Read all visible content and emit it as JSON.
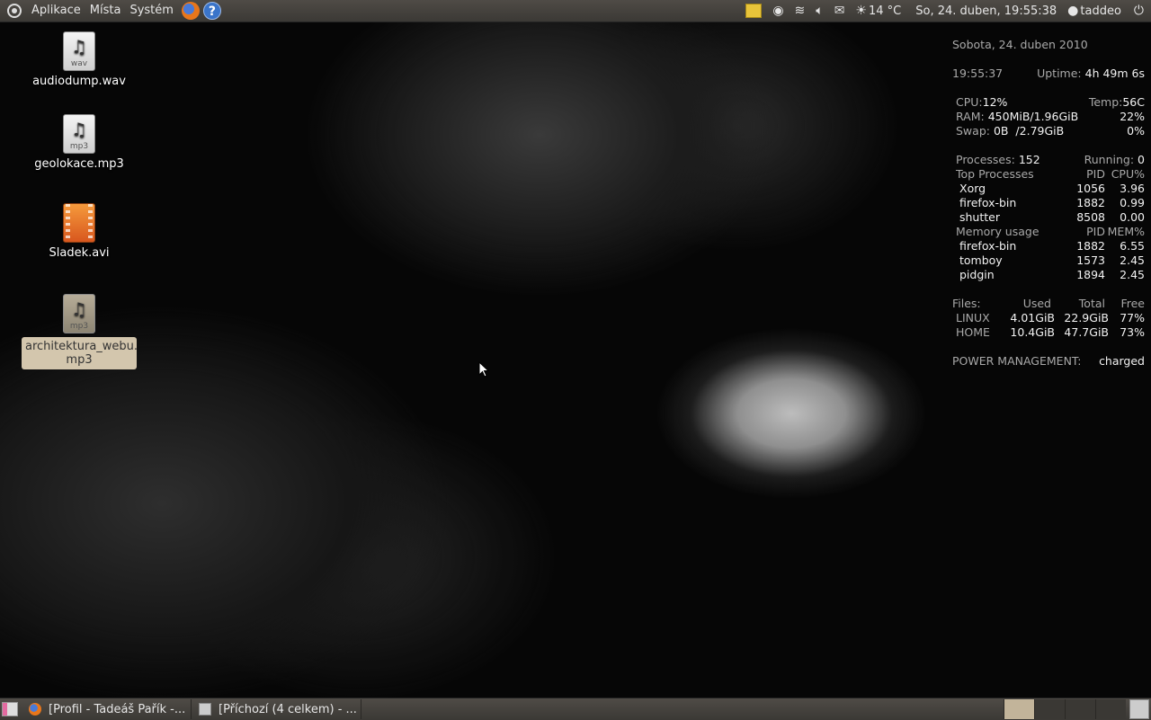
{
  "top_panel": {
    "menus": [
      "Aplikace",
      "Místa",
      "Systém"
    ],
    "temperature": "14 °C",
    "datetime": "So, 24. duben, 19:55:38",
    "user": "taddeo"
  },
  "desktop_icons": [
    {
      "label": "audiodump.wav",
      "ext": "wav",
      "type": "audio"
    },
    {
      "label": "geolokace.mp3",
      "ext": "mp3",
      "type": "audio"
    },
    {
      "label": "Sladek.avi",
      "ext": "",
      "type": "video"
    },
    {
      "label": "architektura_webu.\nmp3",
      "ext": "mp3",
      "type": "audio",
      "selected": true
    }
  ],
  "conky": {
    "date": "Sobota, 24. duben 2010",
    "time": "19:55:37",
    "uptime_label": "Uptime:",
    "uptime": "4h 49m 6s",
    "cpu_label": "CPU:",
    "cpu": "12%",
    "temp_label": "Temp:",
    "temp": "56C",
    "ram_label": "RAM:",
    "ram": "450MiB/1.96GiB",
    "ram_pct": "22%",
    "swap_label": "Swap:",
    "swap": "0B  /2.79GiB",
    "swap_pct": "0%",
    "processes_label": "Processes:",
    "processes": "152",
    "running_label": "Running:",
    "running": "0",
    "top_header": [
      "Top Processes",
      "PID",
      "CPU%"
    ],
    "top_rows": [
      {
        "name": "Xorg",
        "pid": "1056",
        "val": "3.96"
      },
      {
        "name": "firefox-bin",
        "pid": "1882",
        "val": "0.99"
      },
      {
        "name": "shutter",
        "pid": "8508",
        "val": "0.00"
      }
    ],
    "mem_header": [
      "Memory usage",
      "PID",
      "MEM%"
    ],
    "mem_rows": [
      {
        "name": "firefox-bin",
        "pid": "1882",
        "val": "6.55"
      },
      {
        "name": "tomboy",
        "pid": "1573",
        "val": "2.45"
      },
      {
        "name": "pidgin",
        "pid": "1894",
        "val": "2.45"
      }
    ],
    "files_header": [
      "Files:",
      "Used",
      "Total",
      "Free"
    ],
    "files_rows": [
      {
        "name": "LINUX",
        "used": "4.01GiB",
        "total": "22.9GiB",
        "free": "77%"
      },
      {
        "name": "HOME",
        "used": "10.4GiB",
        "total": "47.7GiB",
        "free": "73%"
      }
    ],
    "power_label": "POWER MANAGEMENT:",
    "power": "charged"
  },
  "taskbar": [
    {
      "label": "[Profil - Tadeáš Pařík -..."
    },
    {
      "label": "[Příchozí (4 celkem) - ..."
    }
  ]
}
